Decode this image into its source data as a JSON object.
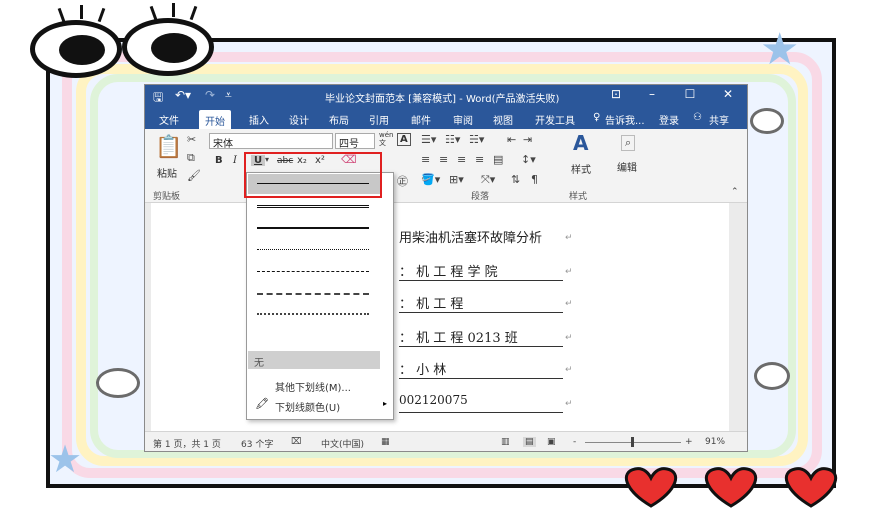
{
  "window": {
    "title": "毕业论文封面范本 [兼容模式] - Word(产品激活失败)",
    "controls": [
      "⊡",
      "–",
      "☐",
      "✕"
    ]
  },
  "tabs": [
    {
      "label": "文件"
    },
    {
      "label": "开始"
    },
    {
      "label": "插入"
    },
    {
      "label": "设计"
    },
    {
      "label": "布局"
    },
    {
      "label": "引用"
    },
    {
      "label": "邮件"
    },
    {
      "label": "审阅"
    },
    {
      "label": "视图"
    },
    {
      "label": "开发工具"
    }
  ],
  "tell_me": "告诉我...",
  "login": "登录",
  "share": "共享",
  "ribbon": {
    "paste": "粘贴",
    "clipboard": "剪贴板",
    "font_name": "宋体",
    "font_size": "四号",
    "bold": "B",
    "italic": "I",
    "underline": "U",
    "strike": "abc",
    "subscript": "x₂",
    "superscript": "x²",
    "wen": "wén\n文",
    "A_box": "A",
    "paragraph": "段落",
    "styles": "样式",
    "styles_group": "样式",
    "edit": "编辑"
  },
  "document": {
    "lines": [
      "用柴油机活塞环故障分析",
      "：  机  工  程  学  院",
      "：  机  工  程",
      "：  机  工  程    0213 班",
      "：  小  林",
      "002120075"
    ]
  },
  "underline_menu": {
    "none": "无",
    "more": "其他下划线(M)...",
    "color": "下划线颜色(U)"
  },
  "status": {
    "page": "第 1 页，共 1 页",
    "words": "63 个字",
    "lang": "中文(中国)",
    "zoom": "91%",
    "minus": "-",
    "plus": "+"
  }
}
